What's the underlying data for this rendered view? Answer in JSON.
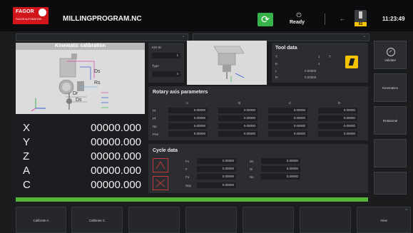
{
  "header": {
    "logo_brand": "FAGOR",
    "logo_sub": "FAGOR AUTOMATION",
    "program_name": "MILLINGPROGRAM.NC",
    "status_icon": "cycle-start-icon",
    "status_text": "Ready",
    "tool_badge": "01",
    "clock": "11:23:49",
    "colors": {
      "brand": "#d2151b",
      "cycle": "#37b24a",
      "tool_badge": "#f5c400"
    }
  },
  "calibration": {
    "title": "Kinematic calibration",
    "labels": {
      "ds": "Ds",
      "rs": "Rs",
      "dr": "Dr",
      "ds2": "Ds"
    }
  },
  "axes": [
    {
      "label": "X",
      "value": "00000.000"
    },
    {
      "label": "Y",
      "value": "00000.000"
    },
    {
      "label": "Z",
      "value": "00000.000"
    },
    {
      "label": "A",
      "value": "00000.000"
    },
    {
      "label": "C",
      "value": "00000.000"
    }
  ],
  "kinematics": {
    "kin_id_label": "KIN ID",
    "kin_id_value": "1",
    "type_label": "Type",
    "type_value": "4"
  },
  "tool_data": {
    "title": "Tool data",
    "rows": [
      {
        "label": "T",
        "value": "1",
        "label2": "T"
      },
      {
        "label": "D",
        "value": "1",
        "label2": ""
      },
      {
        "label": "L",
        "value": "0.00000",
        "label2": ""
      },
      {
        "label": "R",
        "value": "0.00000",
        "label2": ""
      }
    ],
    "icon": "tool-offset-icon"
  },
  "rotary": {
    "title": "Rotary axis parameters",
    "columns": [
      "A",
      "B",
      "C",
      "D"
    ],
    "rows": [
      {
        "label": "Pt",
        "values": [
          "0.00000",
          "0.00000",
          "0.00000",
          "0.00000"
        ]
      },
      {
        "label": "Pf",
        "values": [
          "0.00000",
          "0.00000",
          "0.00000",
          "0.00000"
        ]
      },
      {
        "label": "Np",
        "values": [
          "0.00000",
          "0.00000",
          "0.00000",
          "0.00000"
        ]
      },
      {
        "label": "Pne",
        "values": [
          "0.00000",
          "0.00000",
          "0.00000",
          "0.00000"
        ]
      }
    ]
  },
  "cycle": {
    "title": "Cycle data",
    "left": [
      {
        "label": "Fs",
        "value": "0.00000"
      },
      {
        "label": "F",
        "value": "0.00000"
      },
      {
        "label": "Fa",
        "value": "0.00000"
      },
      {
        "label": "Sep",
        "value": "0.00000"
      }
    ],
    "right": [
      {
        "label": "Ds",
        "value": "0.00000"
      },
      {
        "label": "Di",
        "value": "0.00000"
      },
      {
        "label": "Ns",
        "value": "0.00000"
      }
    ]
  },
  "right_buttons": [
    {
      "label": "Validate",
      "icon": "check-circle-icon"
    },
    {
      "label": "Kinematics",
      "icon": ""
    },
    {
      "label": "Rotational",
      "icon": ""
    },
    {
      "label": "",
      "icon": ""
    },
    {
      "label": "",
      "icon": ""
    }
  ],
  "softkeys": [
    {
      "label": "Calibrate A"
    },
    {
      "label": "Calibrate C"
    },
    {
      "label": ""
    },
    {
      "label": ""
    },
    {
      "label": ""
    },
    {
      "label": ""
    },
    {
      "label": "View"
    }
  ]
}
